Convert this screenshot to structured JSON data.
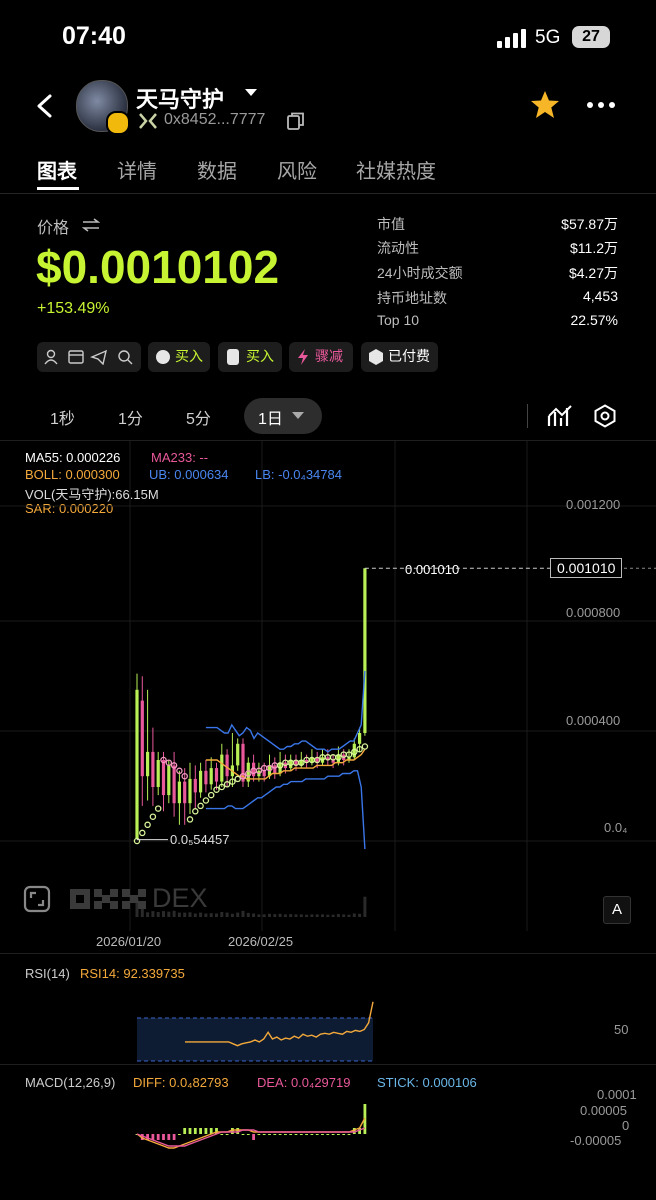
{
  "status": {
    "time": "07:40",
    "network": "5G",
    "battery": "27"
  },
  "token": {
    "name": "天马守护",
    "address": "0x8452...7777"
  },
  "tabs": [
    {
      "label": "图表"
    },
    {
      "label": "详情"
    },
    {
      "label": "数据"
    },
    {
      "label": "风险"
    },
    {
      "label": "社媒热度"
    }
  ],
  "price": {
    "label": "价格",
    "value": "$0.0010102",
    "change": "+153.49%"
  },
  "stats": [
    {
      "label": "市值",
      "value": "$57.87万"
    },
    {
      "label": "流动性",
      "value": "$11.2万"
    },
    {
      "label": "24小时成交额",
      "value": "$4.27万"
    },
    {
      "label": "持币地址数",
      "value": "4,453"
    },
    {
      "label": "Top 10",
      "value": "22.57%"
    }
  ],
  "actions": {
    "buy1": "买入",
    "buy2": "买入",
    "drop": "骤减",
    "paid": "已付费"
  },
  "timeframes": [
    "1秒",
    "1分",
    "5分",
    "1日"
  ],
  "indicators": {
    "ma55": "MA55: 0.000226",
    "ma233": "MA233: --",
    "boll": "BOLL: 0.000300",
    "ub": "UB: 0.000634",
    "lb": "LB: -0.0₄34784",
    "vol": "VOL(天马守护):66.15M",
    "sar": "SAR: 0.000220"
  },
  "price_axis": [
    "0.001200",
    "0.000800",
    "0.000400",
    "0.0₄"
  ],
  "price_tag": "0.001010",
  "price_line_label": "0.001010",
  "low_label": "0.0₅54457",
  "watermark": "DEX",
  "auto_button": "A",
  "dates": [
    "2026/01/20",
    "2026/02/25"
  ],
  "rsi": {
    "title": "RSI(14)",
    "value": "RSI14: 92.339735",
    "axis": "50"
  },
  "macd": {
    "title": "MACD(12,26,9)",
    "diff": "DIFF: 0.0₄82793",
    "dea": "DEA: 0.0₄29719",
    "stick": "STICK: 0.000106",
    "axis": [
      "0.0001",
      "0.00005",
      "0",
      "-0.00005"
    ]
  },
  "colors": {
    "accent": "#c6f432",
    "up": "#b8f055",
    "down": "#e8589a",
    "boll": "#3a76e8",
    "ma": "#f4a93b"
  },
  "chart_data": {
    "type": "candlestick",
    "ylim": [
      0,
      0.0013
    ],
    "candles": [
      {
        "o": 1e-05,
        "c": 0.00056,
        "h": 0.00062,
        "l": 5e-06
      },
      {
        "o": 0.00052,
        "c": 0.00024,
        "h": 0.00061,
        "l": 0.00013
      },
      {
        "o": 0.00024,
        "c": 0.00033,
        "h": 0.00056,
        "l": 0.00015
      },
      {
        "o": 0.00033,
        "c": 0.0002,
        "h": 0.00042,
        "l": 0.00013
      },
      {
        "o": 0.0002,
        "c": 0.0003,
        "h": 0.00033,
        "l": 0.00017
      },
      {
        "o": 0.0003,
        "c": 0.00017,
        "h": 0.00033,
        "l": 0.00011
      },
      {
        "o": 0.00017,
        "c": 0.00028,
        "h": 0.0003,
        "l": 0.00014
      },
      {
        "o": 0.00028,
        "c": 0.00014,
        "h": 0.00033,
        "l": 9e-05
      },
      {
        "o": 0.00014,
        "c": 0.00022,
        "h": 0.00026,
        "l": 6e-05
      },
      {
        "o": 0.00022,
        "c": 0.00014,
        "h": 0.00027,
        "l": 6e-05
      },
      {
        "o": 0.00014,
        "c": 0.00023,
        "h": 0.00029,
        "l": 0.0001
      },
      {
        "o": 0.00023,
        "c": 0.00018,
        "h": 0.00028,
        "l": 0.00012
      },
      {
        "o": 0.00018,
        "c": 0.00026,
        "h": 0.00029,
        "l": 0.00016
      },
      {
        "o": 0.00026,
        "c": 0.00021,
        "h": 0.0003,
        "l": 0.00018
      },
      {
        "o": 0.00021,
        "c": 0.00027,
        "h": 0.00031,
        "l": 0.00019
      },
      {
        "o": 0.00027,
        "c": 0.00022,
        "h": 0.00029,
        "l": 0.00019
      },
      {
        "o": 0.00022,
        "c": 0.00032,
        "h": 0.00036,
        "l": 0.0002
      },
      {
        "o": 0.00032,
        "c": 0.00024,
        "h": 0.00034,
        "l": 0.0002
      },
      {
        "o": 0.00024,
        "c": 0.00028,
        "h": 0.0004,
        "l": 0.0002
      },
      {
        "o": 0.00028,
        "c": 0.00036,
        "h": 0.00038,
        "l": 0.00026
      },
      {
        "o": 0.00036,
        "c": 0.00022,
        "h": 0.00038,
        "l": 0.0002
      },
      {
        "o": 0.00022,
        "c": 0.00029,
        "h": 0.00031,
        "l": 0.0002
      },
      {
        "o": 0.00029,
        "c": 0.00024,
        "h": 0.00032,
        "l": 0.00022
      },
      {
        "o": 0.00024,
        "c": 0.00026,
        "h": 0.00029,
        "l": 0.00022
      },
      {
        "o": 0.00026,
        "c": 0.00024,
        "h": 0.00029,
        "l": 0.00022
      },
      {
        "o": 0.00024,
        "c": 0.00028,
        "h": 0.00032,
        "l": 0.00023
      },
      {
        "o": 0.00028,
        "c": 0.00025,
        "h": 0.00031,
        "l": 0.00023
      },
      {
        "o": 0.00025,
        "c": 0.00029,
        "h": 0.00033,
        "l": 0.00024
      },
      {
        "o": 0.00029,
        "c": 0.00027,
        "h": 0.00032,
        "l": 0.00025
      },
      {
        "o": 0.00027,
        "c": 0.0003,
        "h": 0.00032,
        "l": 0.00026
      },
      {
        "o": 0.0003,
        "c": 0.00028,
        "h": 0.00032,
        "l": 0.00026
      },
      {
        "o": 0.00028,
        "c": 0.0003,
        "h": 0.00033,
        "l": 0.00027
      },
      {
        "o": 0.0003,
        "c": 0.00029,
        "h": 0.00032,
        "l": 0.00027
      },
      {
        "o": 0.00029,
        "c": 0.00031,
        "h": 0.00034,
        "l": 0.00028
      },
      {
        "o": 0.00031,
        "c": 0.00029,
        "h": 0.00033,
        "l": 0.00027
      },
      {
        "o": 0.00029,
        "c": 0.00031,
        "h": 0.00034,
        "l": 0.00028
      },
      {
        "o": 0.00031,
        "c": 0.0003,
        "h": 0.00034,
        "l": 0.00028
      },
      {
        "o": 0.0003,
        "c": 0.00029,
        "h": 0.00032,
        "l": 0.00027
      },
      {
        "o": 0.00029,
        "c": 0.00032,
        "h": 0.00035,
        "l": 0.00028
      },
      {
        "o": 0.00032,
        "c": 0.0003,
        "h": 0.00034,
        "l": 0.00028
      },
      {
        "o": 0.0003,
        "c": 0.00031,
        "h": 0.00034,
        "l": 0.00029
      },
      {
        "o": 0.00031,
        "c": 0.00036,
        "h": 0.00038,
        "l": 0.0003
      },
      {
        "o": 0.00036,
        "c": 0.0004,
        "h": 0.00042,
        "l": 0.00033
      },
      {
        "o": 0.0004,
        "c": 0.00101,
        "h": 0.00101,
        "l": 0.00039
      }
    ],
    "ub": [
      0.00042,
      0.00042,
      0.00042,
      0.00042,
      0.00041,
      0.0004,
      0.0004,
      0.00043,
      0.00041,
      0.00039,
      0.0004,
      0.00042,
      0.00041,
      0.00038,
      0.0004,
      0.00039,
      0.00038,
      0.00037,
      0.00036,
      0.00035,
      0.00034,
      0.00034,
      0.00035,
      0.00035,
      0.00036,
      0.00036,
      0.00037,
      0.00037,
      0.00036,
      0.00035,
      0.00034,
      0.00034,
      0.00034,
      0.00033,
      0.00034,
      0.00034,
      0.00034,
      0.00035,
      0.00036,
      0.00037,
      0.00037,
      0.0004,
      0.00043,
      0.00063
    ],
    "lb": [
      0.00012,
      0.00012,
      0.00012,
      0.00012,
      0.00012,
      0.00012,
      0.00013,
      0.00013,
      0.00012,
      0.00012,
      0.00012,
      0.00013,
      0.00014,
      0.00015,
      0.00016,
      0.00016,
      0.00017,
      0.00018,
      0.00019,
      0.0002,
      0.0002,
      0.00021,
      0.00021,
      0.00022,
      0.00022,
      0.00022,
      0.00022,
      0.00023,
      0.00023,
      0.00023,
      0.00023,
      0.00023,
      0.00023,
      0.00024,
      0.00024,
      0.00024,
      0.00024,
      0.00025,
      0.00025,
      0.00025,
      0.00026,
      0.00026,
      0.0002,
      -3e-05
    ],
    "ma": [
      0.0003,
      0.0003,
      0.0003,
      0.0003,
      0.00029,
      0.00028,
      0.00027,
      0.00026,
      0.00025,
      0.00024,
      0.00024,
      0.00023,
      0.00023,
      0.00023,
      0.00023,
      0.00023,
      0.00023,
      0.00024,
      0.00025,
      0.00025,
      0.00025,
      0.00026,
      0.00026,
      0.00026,
      0.00027,
      0.00027,
      0.00027,
      0.00027,
      0.00027,
      0.00027,
      0.00028,
      0.00028,
      0.00028,
      0.00028,
      0.00028,
      0.00029,
      0.00029,
      0.00029,
      0.0003,
      0.0003,
      0.0003,
      0.00031,
      0.00032,
      0.00034
    ],
    "sar": [
      0.0,
      3e-05,
      6e-05,
      9e-05,
      0.00012,
      0.0003,
      0.00029,
      0.00028,
      0.00026,
      0.00024,
      8e-05,
      0.00011,
      0.00013,
      0.00015,
      0.00017,
      0.00019,
      0.0002,
      0.00021,
      0.00022,
      0.00023,
      0.00024,
      0.00025,
      0.00026,
      0.00026,
      0.00027,
      0.00027,
      0.00028,
      0.00028,
      0.00029,
      0.00029,
      0.00029,
      0.00029,
      0.0003,
      0.0003,
      0.0003,
      0.00031,
      0.00031,
      0.00031,
      0.00031,
      0.00032,
      0.00032,
      0.00033,
      0.00034,
      0.00035
    ],
    "sar_above": [
      5,
      6,
      7,
      8,
      9
    ],
    "sar_above2": [
      20,
      21,
      22,
      23,
      24,
      25,
      26
    ],
    "rsi": [
      50,
      50,
      50,
      50,
      50,
      50,
      50,
      50,
      50,
      50,
      50,
      48,
      46,
      48,
      49,
      50,
      52,
      50,
      53,
      60,
      53,
      55,
      52,
      54,
      53,
      56,
      54,
      58,
      56,
      57,
      55,
      58,
      59,
      58,
      60,
      59,
      58,
      61,
      60,
      62,
      61,
      63,
      70,
      92
    ],
    "macd_diff": [
      0,
      -2e-05,
      -3e-05,
      -4e-05,
      -5e-05,
      -6e-05,
      -7e-05,
      -7e-05,
      -6e-05,
      -5e-05,
      -4e-05,
      -3e-05,
      -2e-05,
      -1e-05,
      0,
      1e-05,
      1e-05,
      1e-05,
      2e-05,
      2e-05,
      2e-05,
      2e-05,
      1e-05,
      1e-05,
      1e-05,
      1e-05,
      1e-05,
      1e-05,
      1e-05,
      1e-05,
      1e-05,
      1e-05,
      1e-05,
      1e-05,
      1e-05,
      1e-05,
      1e-05,
      1e-05,
      1e-05,
      1e-05,
      1e-05,
      2e-05,
      3e-05,
      8e-05
    ],
    "macd_dea": [
      0,
      -1e-05,
      -2e-05,
      -3e-05,
      -4e-05,
      -5e-05,
      -6e-05,
      -6e-05,
      -6e-05,
      -6e-05,
      -5e-05,
      -4e-05,
      -3e-05,
      -2e-05,
      -1e-05,
      0,
      1e-05,
      1e-05,
      1e-05,
      1e-05,
      2e-05,
      2e-05,
      2e-05,
      1e-05,
      1e-05,
      1e-05,
      1e-05,
      1e-05,
      1e-05,
      1e-05,
      1e-05,
      1e-05,
      1e-05,
      1e-05,
      1e-05,
      1e-05,
      1e-05,
      1e-05,
      1e-05,
      1e-05,
      1e-05,
      1e-05,
      2e-05,
      3e-05
    ]
  }
}
